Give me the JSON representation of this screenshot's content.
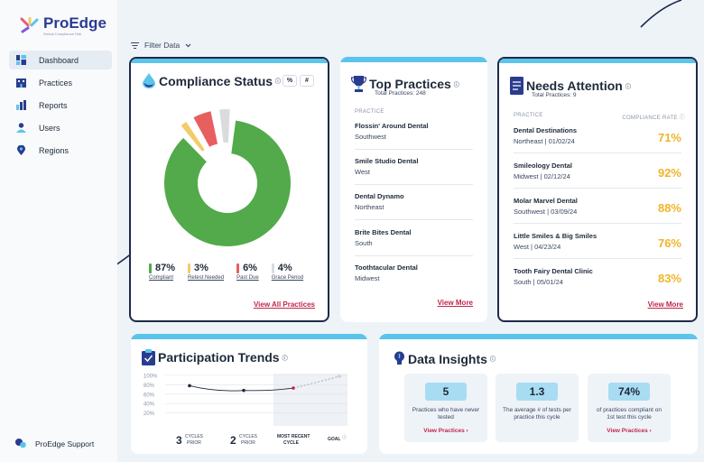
{
  "brand": {
    "name": "ProEdge",
    "tagline": "Dental Compliance Hub"
  },
  "sidebar": {
    "items": [
      {
        "label": "Dashboard"
      },
      {
        "label": "Practices"
      },
      {
        "label": "Reports"
      },
      {
        "label": "Users"
      },
      {
        "label": "Regions"
      }
    ],
    "support_label": "ProEdge Support"
  },
  "filter": {
    "label": "Filter Data"
  },
  "compliance": {
    "title": "Compliance Status",
    "toggle_percent": "%",
    "toggle_count": "#",
    "donut": [
      {
        "name": "Compliant",
        "value": 87,
        "color": "#52aa4a"
      },
      {
        "name": "Retest Needed",
        "value": 3,
        "color": "#f3cb6a"
      },
      {
        "name": "Past Due",
        "value": 6,
        "color": "#e85f5f"
      },
      {
        "name": "Grace Period",
        "value": 4,
        "color": "#d9dbde"
      }
    ],
    "legend": [
      {
        "value": "87%",
        "label": "Compliant"
      },
      {
        "value": "3%",
        "label": "Retest Needed"
      },
      {
        "value": "6%",
        "label": "Past Due"
      },
      {
        "value": "4%",
        "label": "Grace Period"
      }
    ],
    "link": "View All Practices"
  },
  "top_practices": {
    "title": "Top Practices",
    "subtitle": "Total Practices: 248",
    "col": "PRACTICE",
    "rows": [
      {
        "name": "Flossin' Around Dental",
        "region": "Southwest"
      },
      {
        "name": "Smile Studio Dental",
        "region": "West"
      },
      {
        "name": "Dental Dynamo",
        "region": "Northeast"
      },
      {
        "name": "Brite Bites Dental",
        "region": "South"
      },
      {
        "name": "Toothtacular Dental",
        "region": "Midwest"
      }
    ],
    "link": "View More"
  },
  "needs_attention": {
    "title": "Needs Attention",
    "subtitle": "Total Practices: 9",
    "col_practice": "PRACTICE",
    "col_rate": "COMPLIANCE RATE",
    "rows": [
      {
        "name": "Dental Destinations",
        "meta": "Northeast | 01/02/24",
        "rate": "71%"
      },
      {
        "name": "Smileology Dental",
        "meta": "Midwest | 02/12/24",
        "rate": "92%"
      },
      {
        "name": "Molar Marvel Dental",
        "meta": "Southwest | 03/09/24",
        "rate": "88%"
      },
      {
        "name": "Little Smiles & Big Smiles",
        "meta": "West | 04/23/24",
        "rate": "76%"
      },
      {
        "name": "Tooth Fairy Dental Clinic",
        "meta": "South | 05/01/24",
        "rate": "83%"
      }
    ],
    "link": "View More"
  },
  "participation": {
    "title": "Participation Trends",
    "xlabels": [
      {
        "num": "3",
        "text": "CYCLES PRIOR"
      },
      {
        "num": "2",
        "text": "CYCLES PRIOR"
      },
      {
        "num": "",
        "text": "MOST RECENT CYCLE"
      },
      {
        "num": "",
        "text": "GOAL"
      }
    ]
  },
  "insights": {
    "title": "Data Insights",
    "cards": [
      {
        "value": "5",
        "text": "Practices who have never tested",
        "link": "View Practices"
      },
      {
        "value": "1.3",
        "text": "The average # of tests per practice this cycle",
        "link": ""
      },
      {
        "value": "74%",
        "text": "of practices compliant on 1st test this cycle",
        "link": "View Practices"
      }
    ]
  },
  "chart_data": {
    "type": "line",
    "categories": [
      "3 CYCLES PRIOR",
      "2 CYCLES PRIOR",
      "MOST RECENT CYCLE",
      "GOAL"
    ],
    "yticks": [
      "100%",
      "80%",
      "60%",
      "40%",
      "20%"
    ],
    "ylim": [
      0,
      100
    ],
    "values": [
      78,
      68,
      73,
      98
    ]
  }
}
